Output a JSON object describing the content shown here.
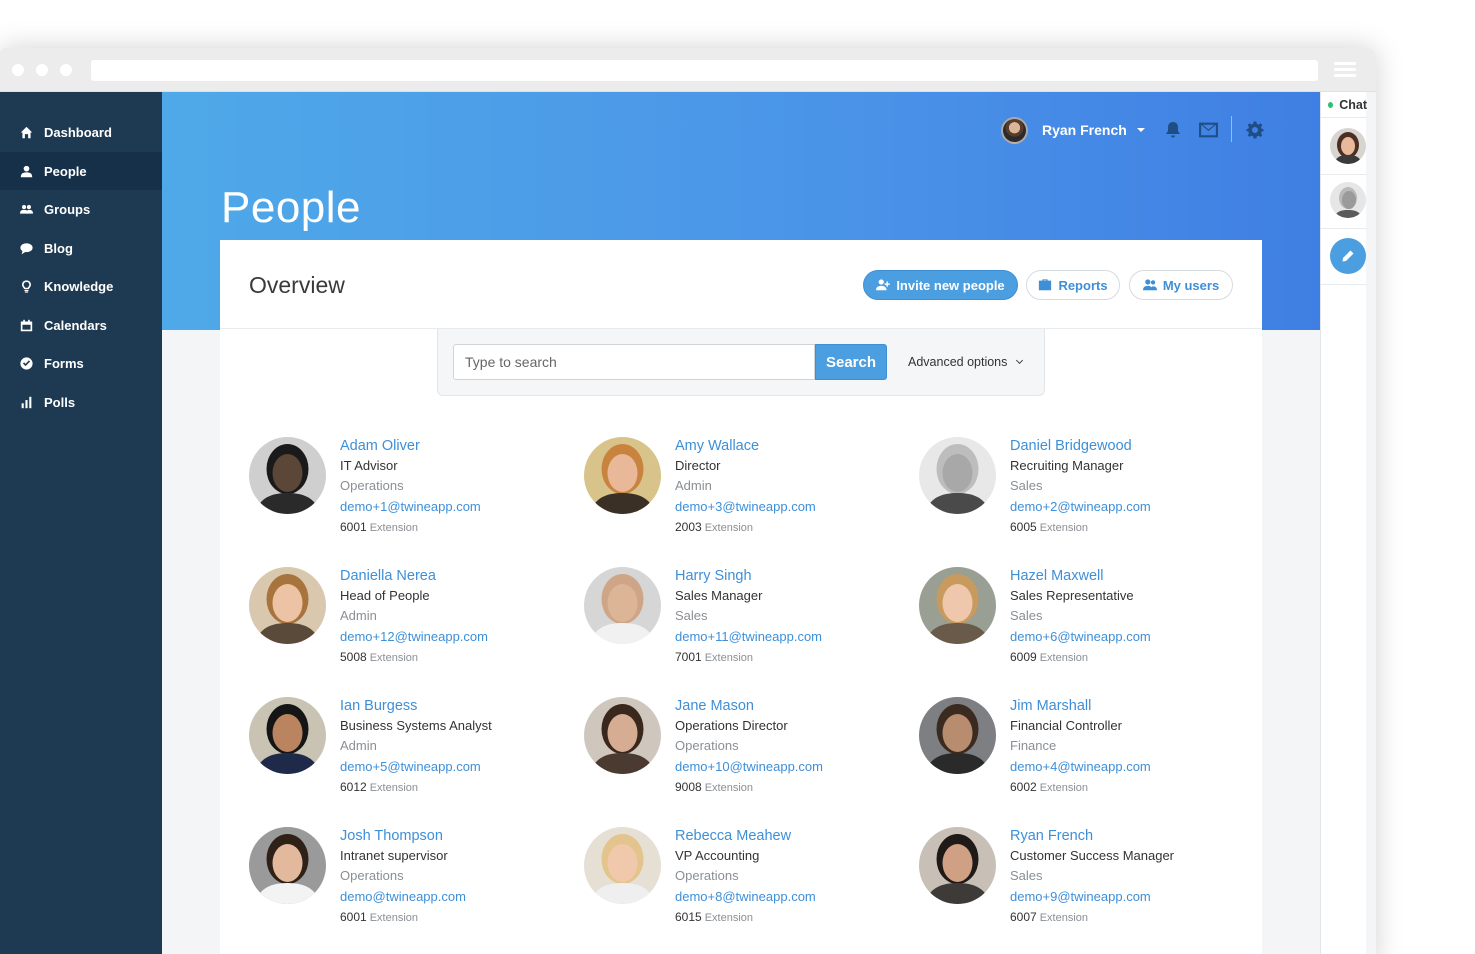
{
  "app": {
    "page_title": "People",
    "card_title": "Overview"
  },
  "topbar": {
    "user_name": "Ryan French",
    "icons": [
      "user-avatar",
      "caret-down-icon",
      "bell-icon",
      "mail-icon",
      "gear-icon"
    ]
  },
  "sidebar": {
    "items": [
      {
        "label": "Dashboard",
        "icon": "home-icon",
        "active": false
      },
      {
        "label": "People",
        "icon": "person-icon",
        "active": true
      },
      {
        "label": "Groups",
        "icon": "group-icon",
        "active": false
      },
      {
        "label": "Blog",
        "icon": "speech-bubble-icon",
        "active": false
      },
      {
        "label": "Knowledge",
        "icon": "lightbulb-icon",
        "active": false
      },
      {
        "label": "Calendars",
        "icon": "calendar-icon",
        "active": false
      },
      {
        "label": "Forms",
        "icon": "check-circle-icon",
        "active": false
      },
      {
        "label": "Polls",
        "icon": "bar-chart-icon",
        "active": false
      }
    ]
  },
  "actions": {
    "invite_label": "Invite new people",
    "reports_label": "Reports",
    "my_users_label": "My users"
  },
  "search": {
    "placeholder": "Type to search",
    "button_label": "Search",
    "advanced_label": "Advanced options"
  },
  "extension_label": "Extension",
  "people": [
    {
      "name": "Adam Oliver",
      "title": "IT Advisor",
      "dept": "Operations",
      "email": "demo+1@twineapp.com",
      "ext": "6001"
    },
    {
      "name": "Amy Wallace",
      "title": "Director",
      "dept": "Admin",
      "email": "demo+3@twineapp.com",
      "ext": "2003"
    },
    {
      "name": "Daniel Bridgewood",
      "title": "Recruiting Manager",
      "dept": "Sales",
      "email": "demo+2@twineapp.com",
      "ext": "6005"
    },
    {
      "name": "Daniella Nerea",
      "title": "Head of People",
      "dept": "Admin",
      "email": "demo+12@twineapp.com",
      "ext": "5008"
    },
    {
      "name": "Harry Singh",
      "title": "Sales Manager",
      "dept": "Sales",
      "email": "demo+11@twineapp.com",
      "ext": "7001"
    },
    {
      "name": "Hazel Maxwell",
      "title": "Sales Representative",
      "dept": "Sales",
      "email": "demo+6@twineapp.com",
      "ext": "6009"
    },
    {
      "name": "Ian Burgess",
      "title": "Business Systems Analyst",
      "dept": "Admin",
      "email": "demo+5@twineapp.com",
      "ext": "6012"
    },
    {
      "name": "Jane Mason",
      "title": "Operations Director",
      "dept": "Operations",
      "email": "demo+10@twineapp.com",
      "ext": "9008"
    },
    {
      "name": "Jim Marshall",
      "title": "Financial Controller",
      "dept": "Finance",
      "email": "demo+4@twineapp.com",
      "ext": "6002"
    },
    {
      "name": "Josh Thompson",
      "title": "Intranet supervisor",
      "dept": "Operations",
      "email": "demo@twineapp.com",
      "ext": "6001"
    },
    {
      "name": "Rebecca Meahew",
      "title": "VP Accounting",
      "dept": "Operations",
      "email": "demo+8@twineapp.com",
      "ext": "6015"
    },
    {
      "name": "Ryan French",
      "title": "Customer Success Manager",
      "dept": "Sales",
      "email": "demo+9@twineapp.com",
      "ext": "6007"
    }
  ],
  "chat": {
    "label": "Chat",
    "status": "online"
  },
  "colors": {
    "sidebar": "#1e3a52",
    "accent": "#3e8fd8",
    "hero_start": "#4fa9e8",
    "hero_end": "#3f7fe3",
    "online": "#2fbf71"
  }
}
